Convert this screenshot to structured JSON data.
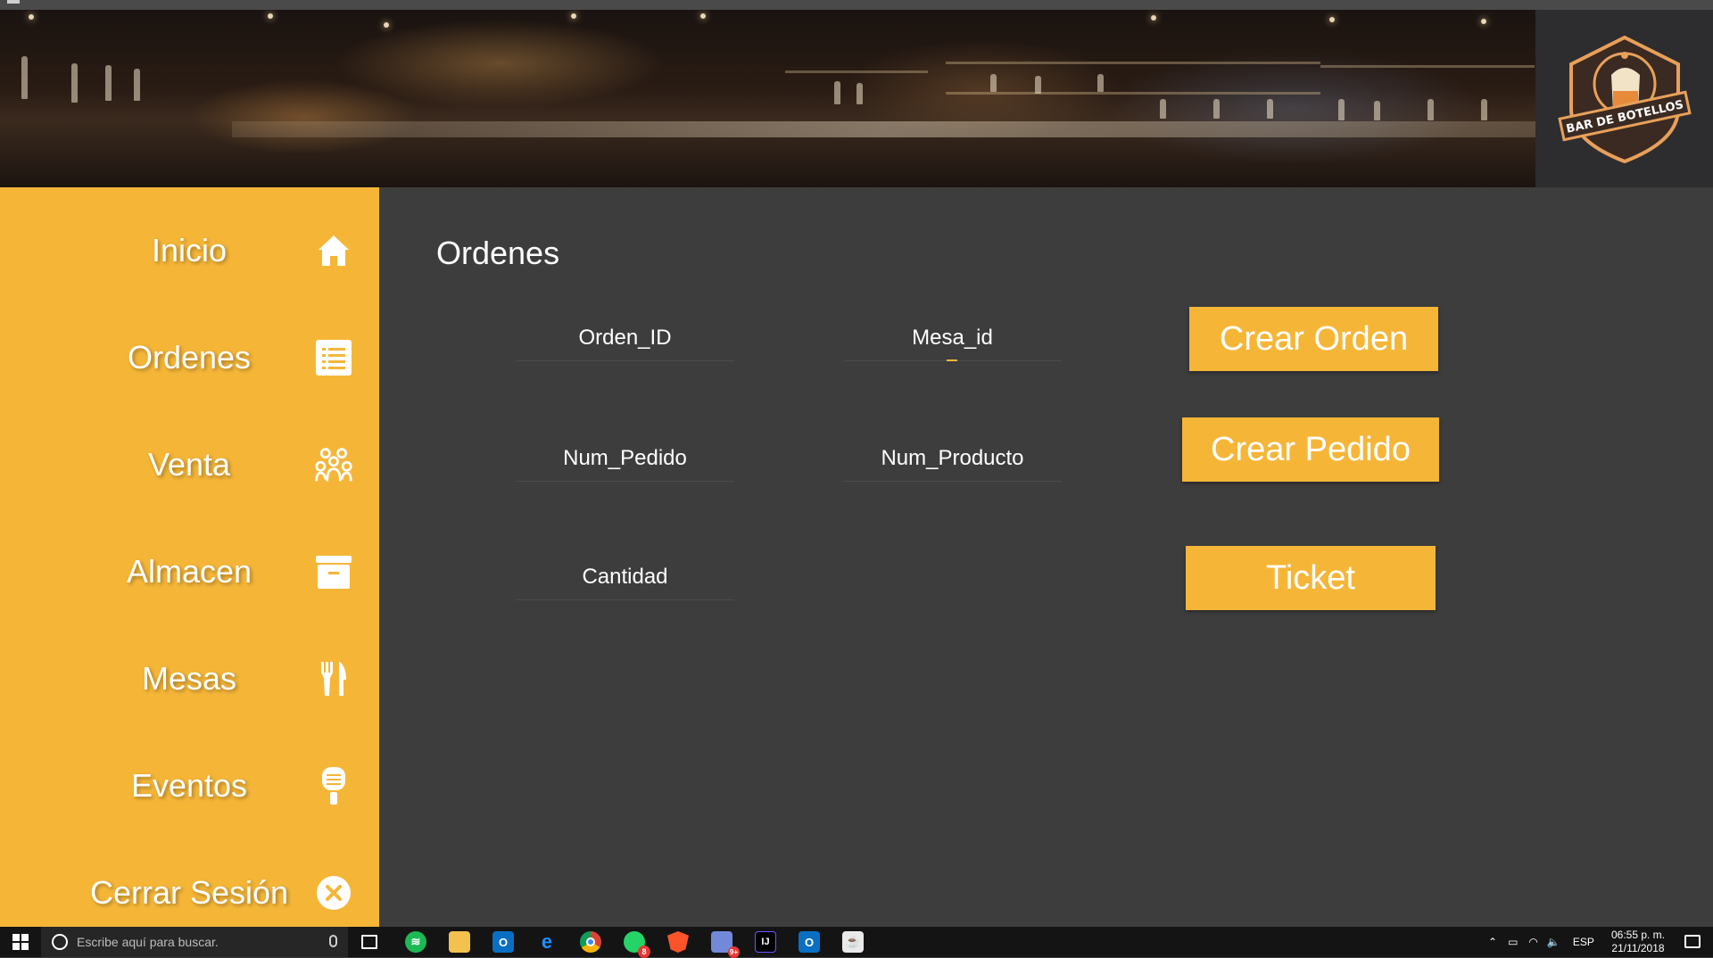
{
  "brand": {
    "logo_text": "BAR DE BOTELLOS",
    "accent": "#f5b638",
    "background": "#3d3d3d"
  },
  "sidebar": {
    "items": [
      {
        "label": "Inicio",
        "icon": "home-icon"
      },
      {
        "label": "Ordenes",
        "icon": "list-icon"
      },
      {
        "label": "Venta",
        "icon": "group-icon"
      },
      {
        "label": "Almacen",
        "icon": "archive-icon"
      },
      {
        "label": "Mesas",
        "icon": "fork-knife-icon"
      },
      {
        "label": "Eventos",
        "icon": "microphone-icon"
      },
      {
        "label": "Cerrar Sesión",
        "icon": "close-circle-icon"
      }
    ]
  },
  "main": {
    "title": "Ordenes",
    "fields": {
      "orden_id": "Orden_ID",
      "mesa_id": "Mesa_id",
      "num_pedido": "Num_Pedido",
      "num_producto": "Num_Producto",
      "cantidad": "Cantidad"
    },
    "buttons": {
      "crear_orden": "Crear Orden",
      "crear_pedido": "Crear Pedido",
      "ticket": "Ticket"
    }
  },
  "taskbar": {
    "search_placeholder": "Escribe aquí para buscar.",
    "language": "ESP",
    "time": "06:55 p. m.",
    "date": "21/11/2018",
    "badges": {
      "whatsapp": "8",
      "discord": "9+"
    }
  }
}
